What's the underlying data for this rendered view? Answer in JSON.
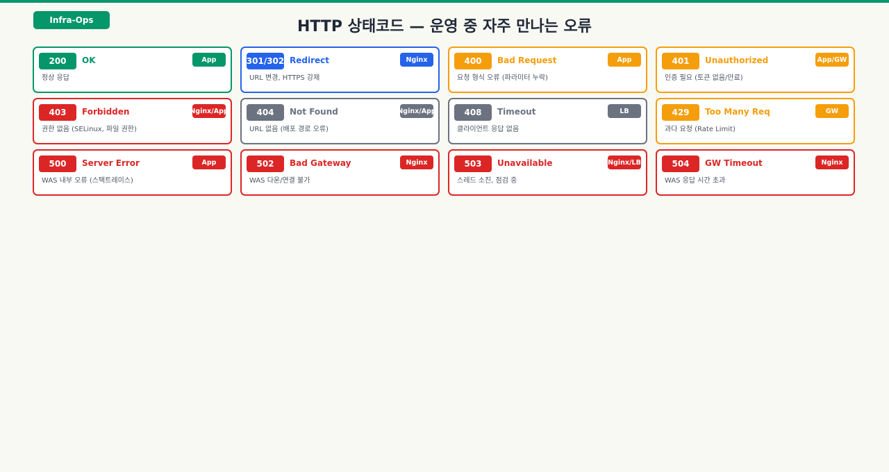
{
  "header": {
    "brand": "Infra-Ops",
    "title": "HTTP 상태코드 — 운영 중 자주 만나는 오류"
  },
  "colors": {
    "green": "#059669",
    "blue": "#2563eb",
    "amber": "#f59e0b",
    "red": "#dc2626",
    "gray": "#6b7280"
  },
  "cards": [
    {
      "code": "200",
      "name": "OK",
      "layer": "App",
      "desc": "정상 응답",
      "color": "#059669"
    },
    {
      "code": "301/302",
      "name": "Redirect",
      "layer": "Nginx",
      "desc": "URL 변경, HTTPS 강제",
      "color": "#2563eb"
    },
    {
      "code": "400",
      "name": "Bad Request",
      "layer": "App",
      "desc": "요청 형식 오류 (파라미터 누락)",
      "color": "#f59e0b"
    },
    {
      "code": "401",
      "name": "Unauthorized",
      "layer": "App/GW",
      "desc": "인증 필요 (토큰 없음/만료)",
      "color": "#f59e0b"
    },
    {
      "code": "403",
      "name": "Forbidden",
      "layer": "Nginx/App",
      "desc": "권한 없음 (SELinux, 파일 권한)",
      "color": "#dc2626"
    },
    {
      "code": "404",
      "name": "Not Found",
      "layer": "Nginx/App",
      "desc": "URL 없음 (배포 경로 오류)",
      "color": "#6b7280"
    },
    {
      "code": "408",
      "name": "Timeout",
      "layer": "LB",
      "desc": "클라이언트 응답 없음",
      "color": "#6b7280"
    },
    {
      "code": "429",
      "name": "Too Many Req",
      "layer": "GW",
      "desc": "과다 요청 (Rate Limit)",
      "color": "#f59e0b"
    },
    {
      "code": "500",
      "name": "Server Error",
      "layer": "App",
      "desc": "WAS 내부 오류 (스택트레이스)",
      "color": "#dc2626"
    },
    {
      "code": "502",
      "name": "Bad Gateway",
      "layer": "Nginx",
      "desc": "WAS 다운/연결 불가",
      "color": "#dc2626"
    },
    {
      "code": "503",
      "name": "Unavailable",
      "layer": "Nginx/LB",
      "desc": "스레드 소진, 점검 중",
      "color": "#dc2626"
    },
    {
      "code": "504",
      "name": "GW Timeout",
      "layer": "Nginx",
      "desc": "WAS 응답 시간 초과",
      "color": "#dc2626"
    }
  ]
}
